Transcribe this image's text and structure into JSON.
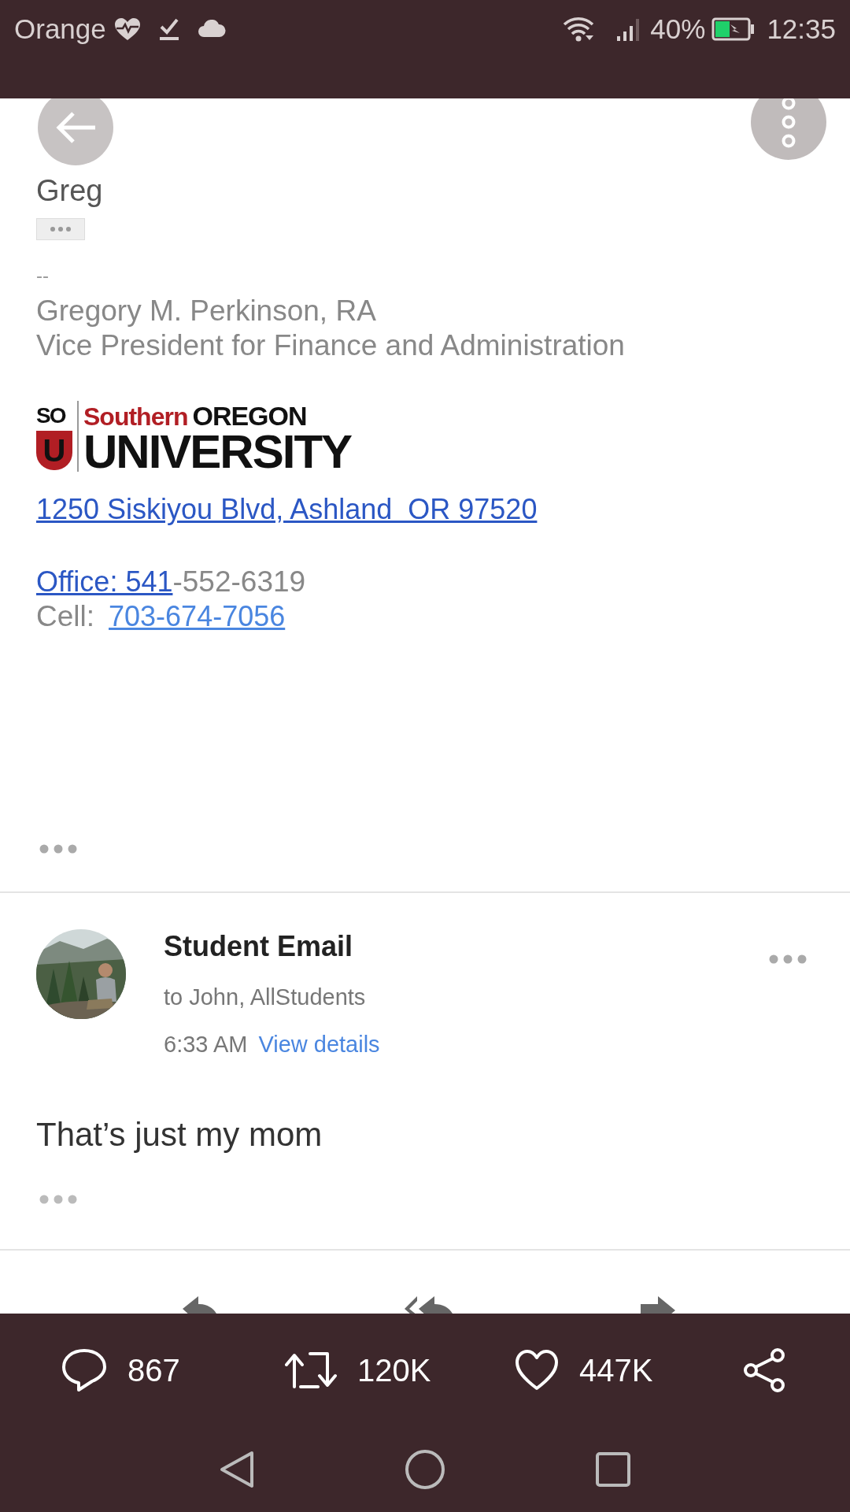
{
  "status_bar": {
    "carrier": "Orange",
    "battery": "40%",
    "time": "12:35"
  },
  "email": {
    "greeting": "Greg",
    "signature": {
      "separator": "--",
      "name": "Gregory M. Perkinson, RA",
      "title": "Vice President for Finance and Administration",
      "logo": {
        "mark_top": "SO",
        "mark_bottom": "U",
        "word_1": "Southern",
        "word_2": "OREGON",
        "word_3": "UNIVERSITY"
      },
      "address": "1250 Siskiyou Blvd, Ashland  OR 97520",
      "office_link": "Office: 541",
      "office_rest": "-552-6319",
      "cell_label": "Cell:",
      "cell_number": "703-674-7056"
    }
  },
  "message": {
    "sender": "Student Email",
    "recipients": "to John, AllStudents",
    "time": "6:33 AM",
    "details_link": "View details",
    "body": "That’s just my mom"
  },
  "tweet_actions": [
    {
      "kind": "reply",
      "count": "867"
    },
    {
      "kind": "retweet",
      "count": "120K"
    },
    {
      "kind": "like",
      "count": "447K"
    },
    {
      "kind": "share"
    }
  ]
}
